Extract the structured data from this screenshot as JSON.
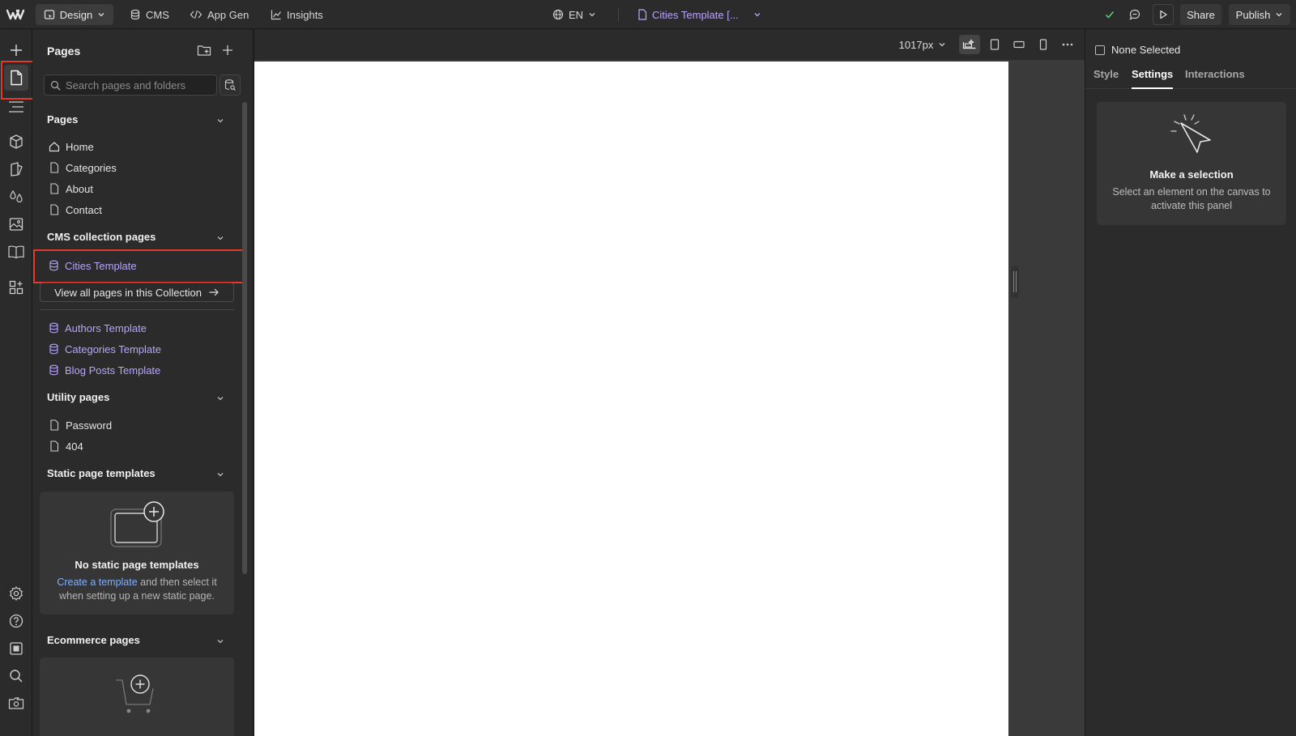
{
  "topbar": {
    "design_label": "Design",
    "cms_label": "CMS",
    "appgen_label": "App Gen",
    "insights_label": "Insights",
    "language": "EN",
    "current_page": "Cities Template [...",
    "share_label": "Share",
    "publish_label": "Publish"
  },
  "rail": {
    "icons": [
      "add-icon",
      "pages-icon",
      "navigator-icon",
      "components-icon",
      "style-manager-icon",
      "variables-icon",
      "assets-icon",
      "cms-book-icon",
      "apps-icon",
      "settings-icon",
      "help-icon",
      "audit-icon",
      "search-icon",
      "video-icon"
    ]
  },
  "pages_panel": {
    "title": "Pages",
    "search_placeholder": "Search pages and folders",
    "sections": {
      "pages": {
        "label": "Pages",
        "items": [
          "Home",
          "Categories",
          "About",
          "Contact"
        ]
      },
      "cms": {
        "label": "CMS collection pages",
        "selected_item": "Cities Template",
        "view_all_label": "View all pages in this Collection",
        "items": [
          "Authors Template",
          "Categories Template",
          "Blog Posts Template"
        ]
      },
      "utility": {
        "label": "Utility pages",
        "items": [
          "Password",
          "404"
        ]
      },
      "static": {
        "label": "Static page templates",
        "empty_title": "No static page templates",
        "empty_link": "Create a template",
        "empty_text": " and then select it when setting up a new static page."
      },
      "ecommerce": {
        "label": "Ecommerce pages"
      }
    }
  },
  "canvas": {
    "width_label": "1017px"
  },
  "right_panel": {
    "none_selected": "None Selected",
    "tabs": [
      "Style",
      "Settings",
      "Interactions"
    ],
    "active_tab": "Settings",
    "selection_title": "Make a selection",
    "selection_text": "Select an element on the canvas to activate this panel"
  },
  "colors": {
    "accent_purple": "#b9a4ff",
    "highlight_red": "#e03a2a",
    "link_blue": "#7fb0ff",
    "panel_bg": "#2b2b2b"
  }
}
